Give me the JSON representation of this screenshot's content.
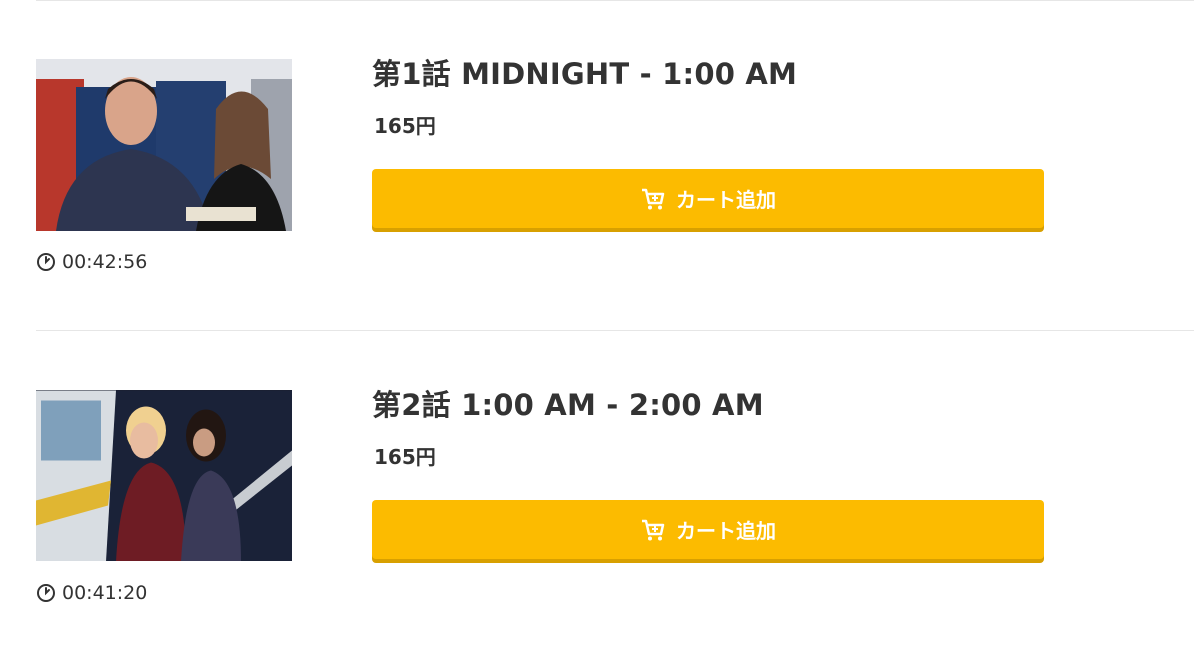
{
  "episodes": [
    {
      "title": "第1話 MIDNIGHT - 1:00 AM",
      "price": "165円",
      "duration": "00:42:56",
      "button_label": "カート追加",
      "thumbnail": "episode-1-still"
    },
    {
      "title": "第2話 1:00 AM - 2:00 AM",
      "price": "165円",
      "duration": "00:41:20",
      "button_label": "カート追加",
      "thumbnail": "episode-2-still"
    }
  ],
  "colors": {
    "button": "#fcbb00",
    "button_shadow": "#d8a000",
    "text": "#333333",
    "divider": "#e6e6e6"
  },
  "icons": {
    "duration": "clock-icon",
    "cart": "cart-icon"
  }
}
